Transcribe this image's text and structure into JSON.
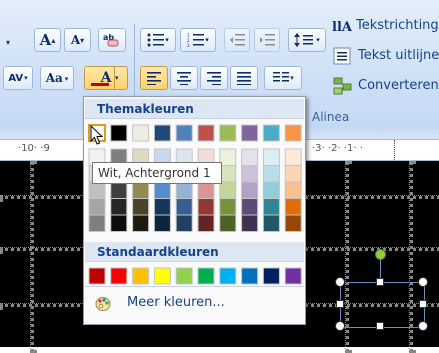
{
  "ribbon": {
    "increase_font": "A",
    "decrease_font": "A",
    "char_spacing": "AV",
    "change_case": "Aa",
    "font_color": "A",
    "text_direction": "Tekstrichting",
    "align_text": "Tekst uitlijnen",
    "convert": "Converteren",
    "group_paragraph": "Alinea"
  },
  "ruler": {
    "left_text": "·10· ·9",
    "right_text": "·3· ·2· ·1· ·"
  },
  "color_panel": {
    "theme_header": "Themakleuren",
    "standard_header": "Standaardkleuren",
    "more_colors": "Meer kleuren...",
    "theme_colors": [
      "#ffffff",
      "#000000",
      "#eeece1",
      "#1f497d",
      "#4f81bd",
      "#c0504d",
      "#9bbb59",
      "#8064a2",
      "#4bacc6",
      "#f79646"
    ],
    "theme_shades": [
      [
        "#f2f2f2",
        "#d8d8d8",
        "#bfbfbf",
        "#a5a5a5",
        "#7f7f7f"
      ],
      [
        "#7f7f7f",
        "#595959",
        "#3f3f3f",
        "#262626",
        "#0c0c0c"
      ],
      [
        "#ddd9c3",
        "#c4bd97",
        "#938953",
        "#494429",
        "#1d1b10"
      ],
      [
        "#c6d9f0",
        "#8db3e2",
        "#548dd4",
        "#17365d",
        "#0f243e"
      ],
      [
        "#dbe5f1",
        "#b8cce4",
        "#95b3d7",
        "#366092",
        "#244061"
      ],
      [
        "#f2dcdb",
        "#e5b9b7",
        "#d99694",
        "#953734",
        "#632423"
      ],
      [
        "#ebf1dd",
        "#d7e3bc",
        "#c3d69b",
        "#76923c",
        "#4f6128"
      ],
      [
        "#e5e0ec",
        "#ccc1d9",
        "#b2a2c7",
        "#5f497a",
        "#3f3151"
      ],
      [
        "#dbeef3",
        "#b7dde8",
        "#92cddc",
        "#31859b",
        "#205867"
      ],
      [
        "#fdeada",
        "#fbd5b5",
        "#fac08f",
        "#e36c09",
        "#974806"
      ]
    ],
    "standard_colors": [
      "#c00000",
      "#ff0000",
      "#ffc000",
      "#ffff00",
      "#92d050",
      "#00b050",
      "#00b0f0",
      "#0070c0",
      "#002060",
      "#7030a0"
    ]
  },
  "tooltip": "Wit, Achtergrond 1"
}
